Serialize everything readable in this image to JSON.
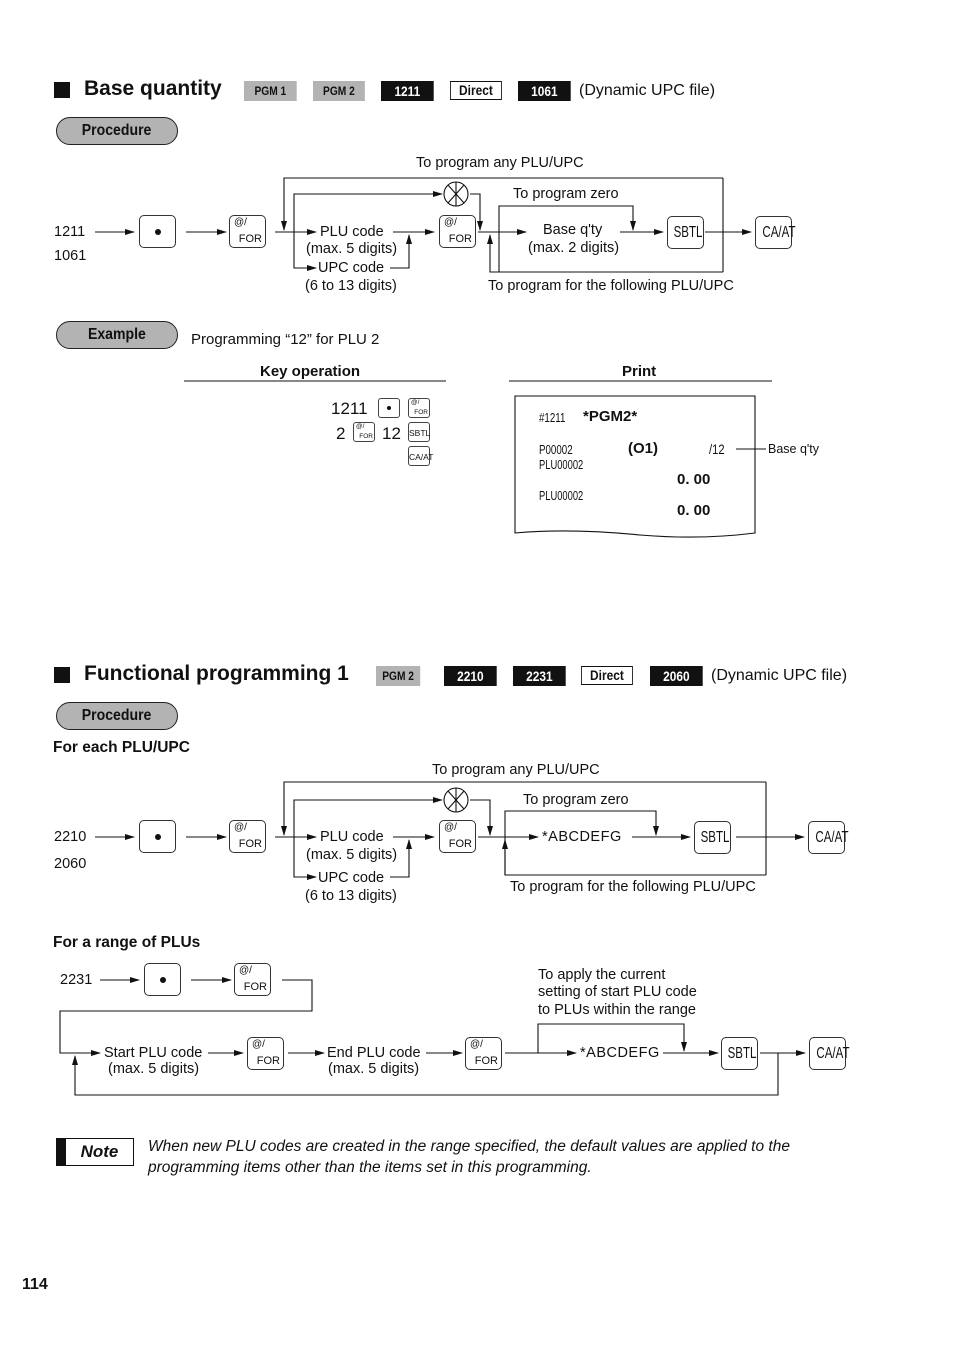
{
  "page_number": "114",
  "section1": {
    "title": "Base quantity",
    "tags": [
      {
        "label": "PGM 1",
        "style": "gray"
      },
      {
        "label": "PGM 2",
        "style": "gray"
      },
      {
        "label": "1211",
        "style": "black"
      },
      {
        "label": "Direct",
        "style": "outline"
      },
      {
        "label": "1061",
        "style": "black"
      }
    ],
    "file_note": "(Dynamic UPC file)",
    "procedure_label": "Procedure",
    "diagram": {
      "codes": [
        "1211",
        "1061"
      ],
      "loop_any_label": "To program any PLU/UPC",
      "zero_label": "To program zero",
      "plu_code": "PLU code",
      "plu_code_sub": "(max. 5 digits)",
      "upc_code": "UPC code",
      "upc_code_sub": "(6 to 13 digits)",
      "base_qty": "Base q'ty",
      "base_qty_sub": "(max. 2 digits)",
      "following_label": "To program for the following PLU/UPC",
      "keys": {
        "dot": "•",
        "for_top": "@/",
        "for_bottom": "FOR",
        "sbtl": "SBTL",
        "caat": "CA/AT"
      }
    },
    "example": {
      "label": "Example",
      "description": "Programming “12” for PLU 2",
      "key_operation_header": "Key operation",
      "print_header": "Print",
      "key_ops": {
        "line1_num": "1211",
        "line2_num1": "2",
        "line2_num2": "12"
      },
      "receipt": {
        "line1_a": "#1211",
        "line1_b": "*PGM2*",
        "line2_a": "P00002",
        "line2_b": "(O1)",
        "line2_c": "/12",
        "line3": "PLU00002",
        "line4": "0. 00",
        "line5": "PLU00002",
        "line6": "0. 00",
        "callout": "Base q'ty"
      }
    }
  },
  "section2": {
    "title": "Functional programming 1",
    "tags": [
      {
        "label": "PGM 2",
        "style": "gray"
      },
      {
        "label": "2210",
        "style": "black"
      },
      {
        "label": "2231",
        "style": "black"
      },
      {
        "label": "Direct",
        "style": "outline"
      },
      {
        "label": "2060",
        "style": "black"
      }
    ],
    "file_note": "(Dynamic UPC file)",
    "procedure_label": "Procedure",
    "each_heading": "For each PLU/UPC",
    "each_diagram": {
      "codes": [
        "2210",
        "2060"
      ],
      "loop_any_label": "To program any PLU/UPC",
      "zero_label": "To program zero",
      "plu_code": "PLU code",
      "plu_code_sub": "(max. 5 digits)",
      "upc_code": "UPC code",
      "upc_code_sub": "(6 to 13 digits)",
      "value": "*ABCDEFG",
      "following_label": "To program for the following PLU/UPC"
    },
    "range_heading": "For a range of PLUs",
    "range_diagram": {
      "code": "2231",
      "start_plu": "Start PLU code",
      "start_plu_sub": "(max. 5 digits)",
      "end_plu": "End PLU code",
      "end_plu_sub": "(max. 5 digits)",
      "value": "*ABCDEFG",
      "apply_label_lines": [
        "To apply the current",
        "setting of start PLU code",
        "to PLUs within the range"
      ]
    }
  },
  "note": {
    "label": "Note",
    "text": "When new PLU codes are created in the range specified, the default values are applied to the programming items other than the items set in this programming."
  }
}
